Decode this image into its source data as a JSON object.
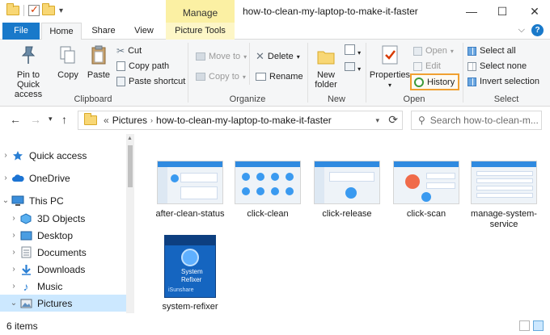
{
  "window": {
    "title": "how-to-clean-my-laptop-to-make-it-faster",
    "manage_tab": "Manage",
    "controls": {
      "minimize": "—",
      "maximize": "☐",
      "close": "✕"
    }
  },
  "ribbon_tabs": {
    "file": "File",
    "home": "Home",
    "share": "Share",
    "view": "View",
    "picture_tools": "Picture Tools"
  },
  "ribbon": {
    "clipboard": {
      "label": "Clipboard",
      "pin_line1": "Pin to Quick",
      "pin_line2": "access",
      "copy": "Copy",
      "paste": "Paste",
      "cut": "Cut",
      "copy_path": "Copy path",
      "paste_shortcut": "Paste shortcut"
    },
    "organize": {
      "label": "Organize",
      "move_to": "Move to",
      "copy_to": "Copy to",
      "delete": "Delete",
      "rename": "Rename"
    },
    "new": {
      "label": "New",
      "new_folder_line1": "New",
      "new_folder_line2": "folder"
    },
    "open": {
      "label": "Open",
      "properties": "Properties",
      "open": "Open",
      "edit": "Edit",
      "history": "History"
    },
    "select": {
      "label": "Select",
      "select_all": "Select all",
      "select_none": "Select none",
      "invert_selection": "Invert selection"
    },
    "highlight_color": "#f0a030"
  },
  "address": {
    "prefix": "«",
    "crumbs": [
      "Pictures",
      "how-to-clean-my-laptop-to-make-it-faster"
    ],
    "search_placeholder": "Search how-to-clean-m..."
  },
  "nav_pane": {
    "items": [
      {
        "label": "Quick access",
        "icon": "star-icon"
      },
      {
        "label": "OneDrive",
        "icon": "cloud-icon"
      },
      {
        "label": "This PC",
        "icon": "computer-icon"
      },
      {
        "label": "3D Objects",
        "icon": "cube-icon"
      },
      {
        "label": "Desktop",
        "icon": "desktop-icon"
      },
      {
        "label": "Documents",
        "icon": "document-icon"
      },
      {
        "label": "Downloads",
        "icon": "download-icon"
      },
      {
        "label": "Music",
        "icon": "music-icon"
      },
      {
        "label": "Pictures",
        "icon": "pictures-icon"
      }
    ]
  },
  "files": [
    {
      "name": "after-clean-status"
    },
    {
      "name": "click-clean"
    },
    {
      "name": "click-release"
    },
    {
      "name": "click-scan"
    },
    {
      "name": "manage-system-service"
    },
    {
      "name": "system-refixer"
    }
  ],
  "boxart": {
    "line1": "System",
    "line2": "Refixer",
    "brand": "iSunshare"
  },
  "status": {
    "count": "6 items"
  }
}
